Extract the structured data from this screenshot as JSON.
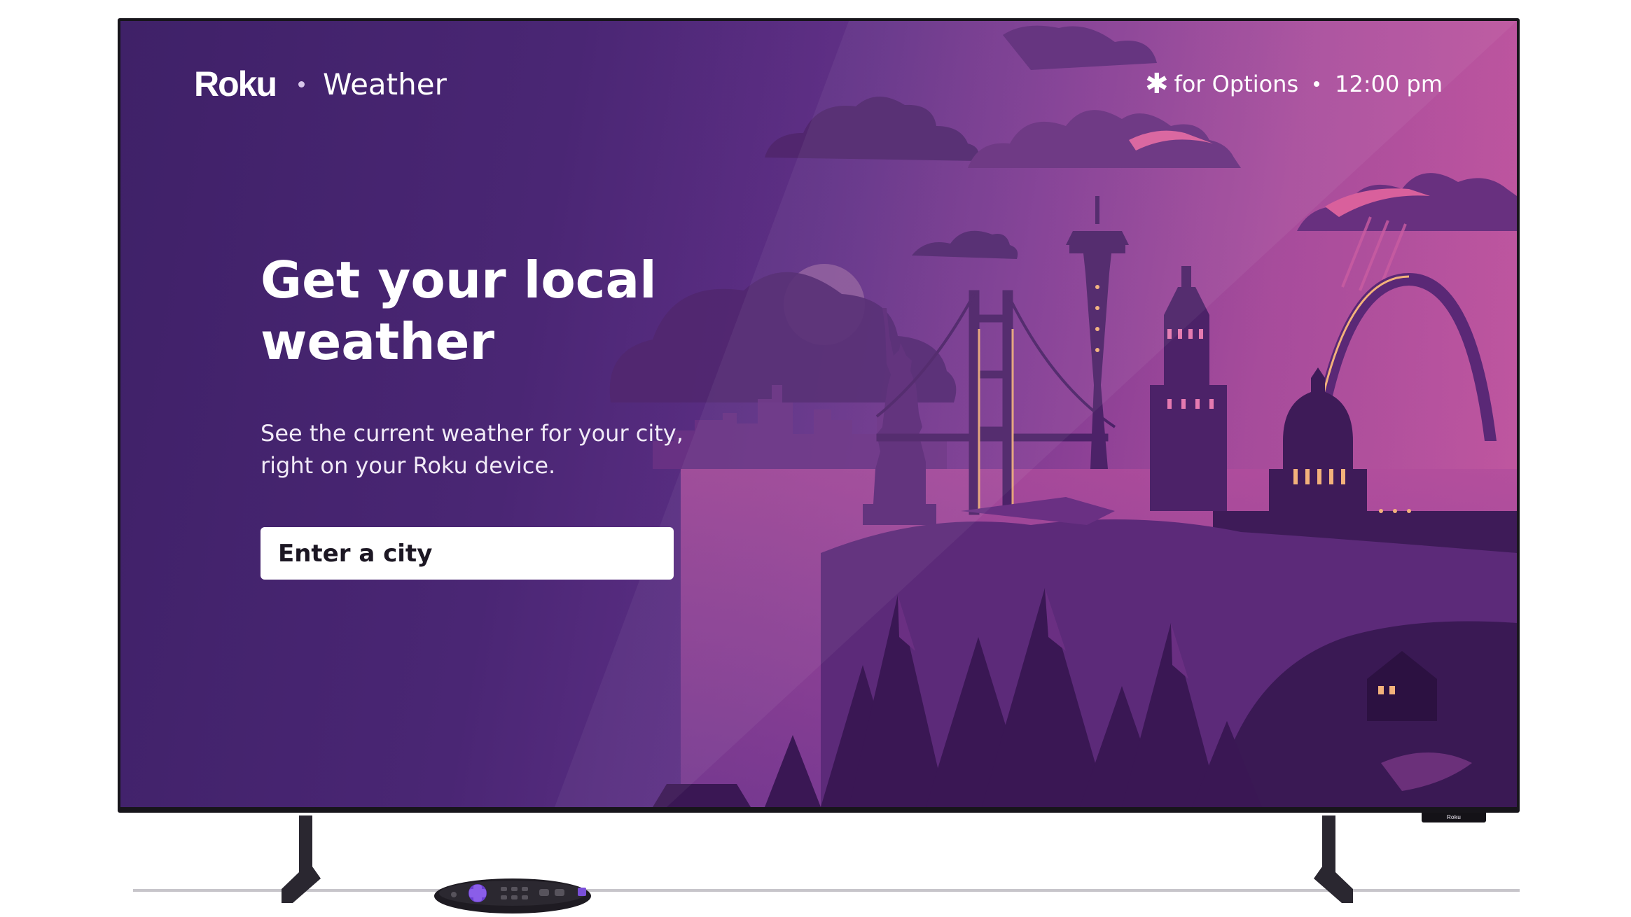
{
  "header": {
    "brand_logo": "Roku",
    "app_name": "Weather",
    "options_icon": "asterisk-icon",
    "options_label": "for Options",
    "clock": "12:00 pm"
  },
  "hero": {
    "headline": "Get your local weather",
    "subtext": "See the current weather for your city, right on your Roku device."
  },
  "search": {
    "placeholder": "Enter a city"
  },
  "device": {
    "tv_badge": "Roku"
  },
  "colors": {
    "background_start": "#3f2168",
    "background_end": "#b4519f",
    "accent_pink": "#d9609c",
    "text": "#ffffff",
    "input_background": "#ffffff",
    "remote_purple": "#6b3fd0"
  }
}
